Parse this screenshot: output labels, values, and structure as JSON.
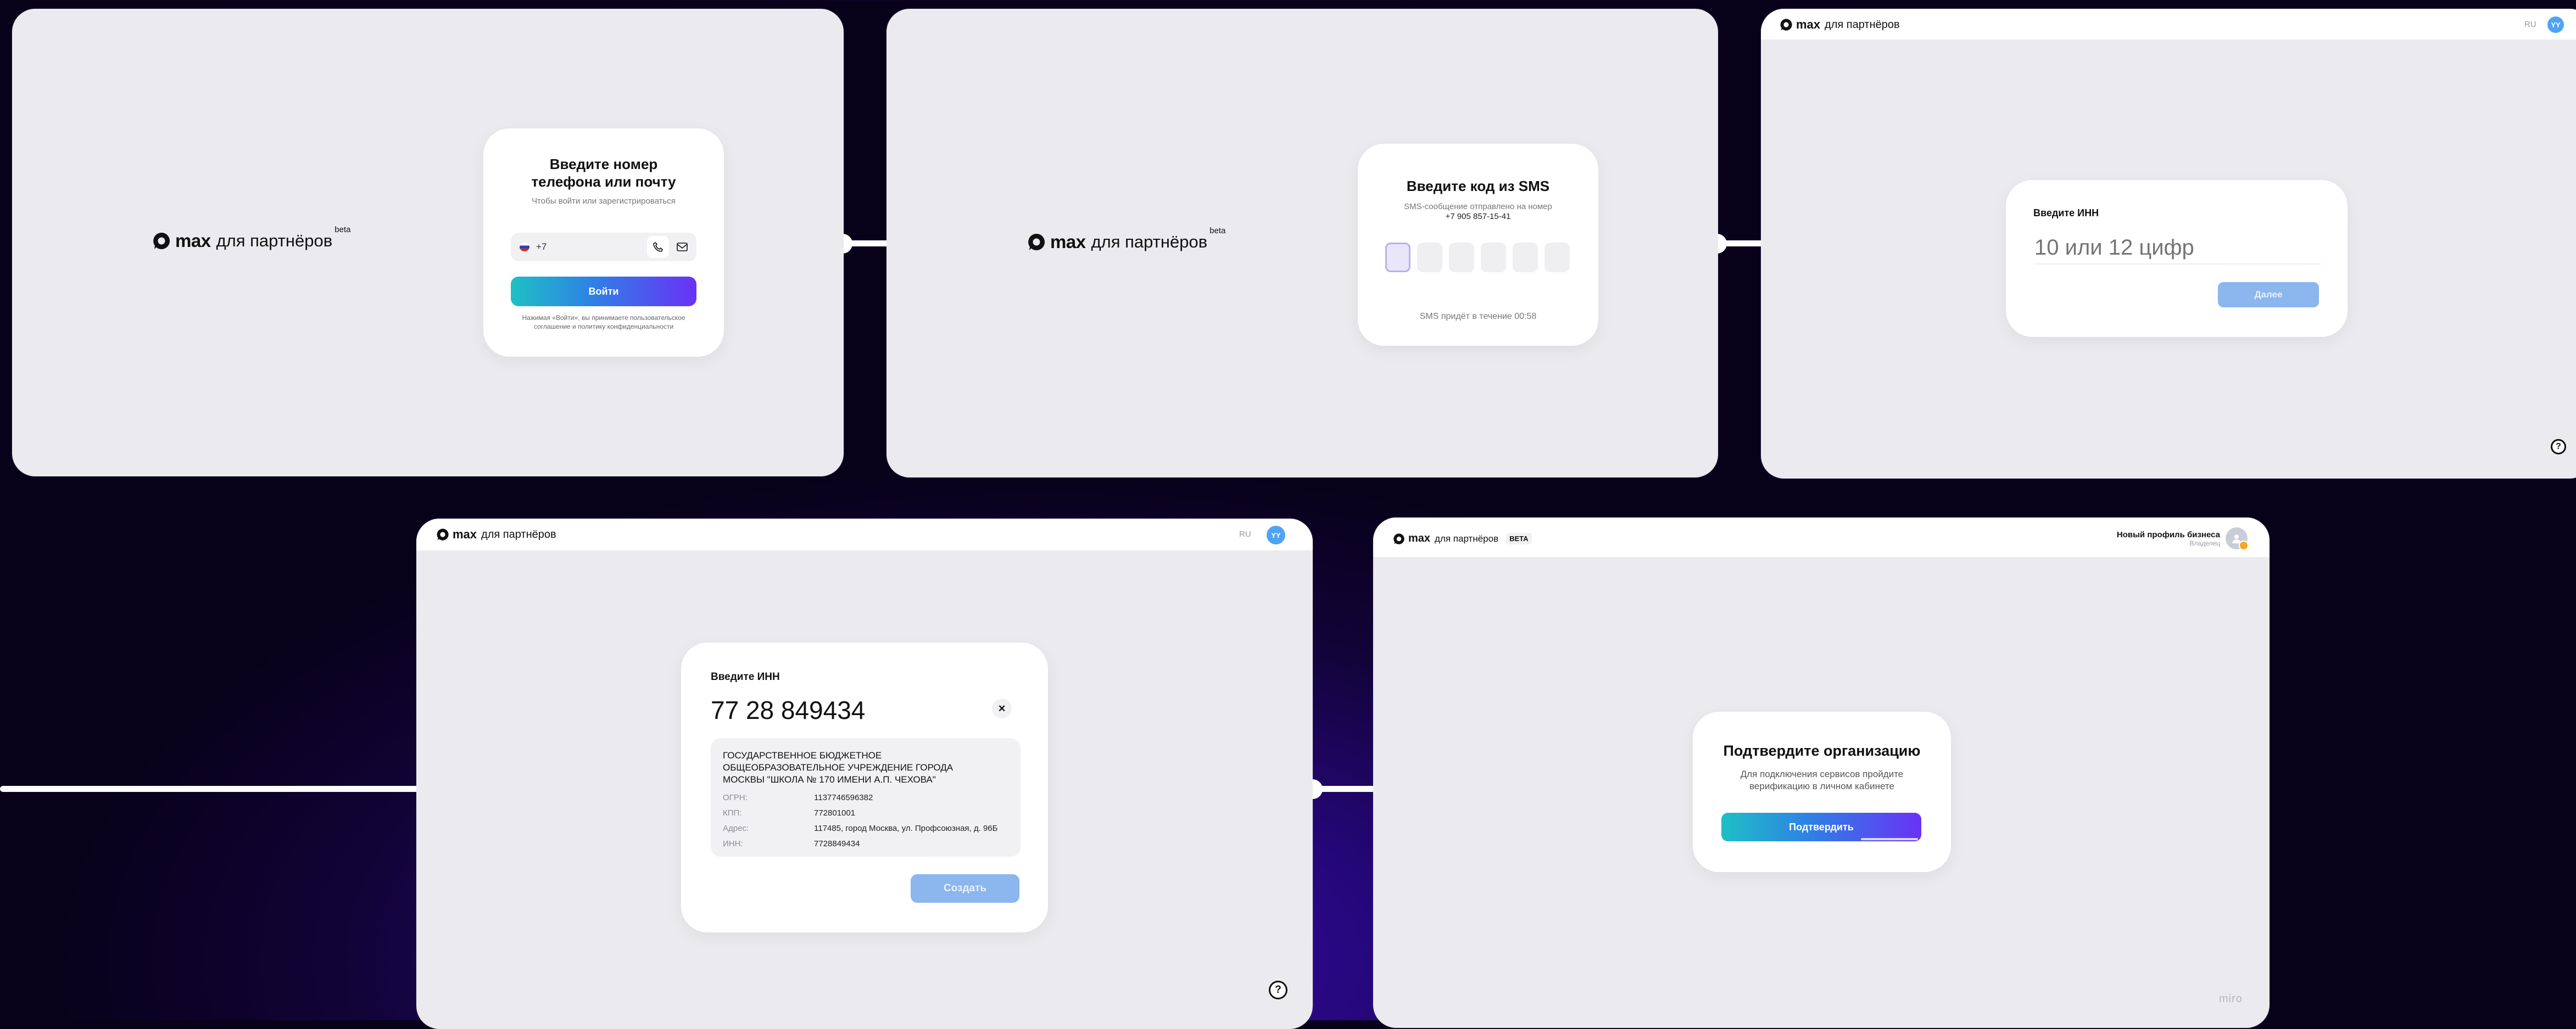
{
  "brand": {
    "max": "max",
    "partners": "для партнёров",
    "beta": "beta",
    "beta_caps": "BETA"
  },
  "screen1": {
    "title_line1": "Введите номер",
    "title_line2": "телефона или почту",
    "subtitle": "Чтобы войти или зарегистрироваться",
    "phone_prefix": "+7",
    "login_button": "Войти",
    "terms_line1": "Нажимая «Войти», вы принимаете пользовательское",
    "terms_line2": "соглашение и политику конфиденциальности"
  },
  "screen2": {
    "title": "Введите код из SMS",
    "sent_to": "SMS-сообщение отправлено на номер",
    "phone": "+7 905 857-15-41",
    "timer": "SMS придёт в течение 00:58"
  },
  "screen3": {
    "lang": "RU",
    "avatar": "YY",
    "label": "Введите ИНН",
    "placeholder": "10 или 12 цифр",
    "next_button": "Далее",
    "help": "?"
  },
  "screen4": {
    "lang": "RU",
    "avatar": "YY",
    "label": "Введите ИНН",
    "inn_value": "77 28 849434",
    "clear": "×",
    "org_name_line1": "ГОСУДАРСТВЕННОЕ БЮДЖЕТНОЕ",
    "org_name_line2": "ОБЩЕОБРАЗОВАТЕЛЬНОЕ УЧРЕЖДЕНИЕ ГОРОДА",
    "org_name_line3": "МОСКВЫ \"ШКОЛА № 170 ИМЕНИ А.П. ЧЕХОВА\"",
    "rows": [
      {
        "k": "ОГРН:",
        "v": "1137746596382"
      },
      {
        "k": "КПП:",
        "v": "772801001"
      },
      {
        "k": "Адрес:",
        "v": "117485, город Москва, ул. Профсоюзная, д. 96Б"
      },
      {
        "k": "ИНН:",
        "v": "7728849434"
      }
    ],
    "create_button": "Создать",
    "help": "?"
  },
  "screen5": {
    "profile_name": "Новый профиль бизнеса",
    "profile_role": "Владелец",
    "title": "Подтвердите организацию",
    "desc_line1": "Для подключения сервисов пройдите",
    "desc_line2": "верификацию в личном кабинете",
    "confirm_button": "Подтвердить",
    "watermark": "miro"
  }
}
